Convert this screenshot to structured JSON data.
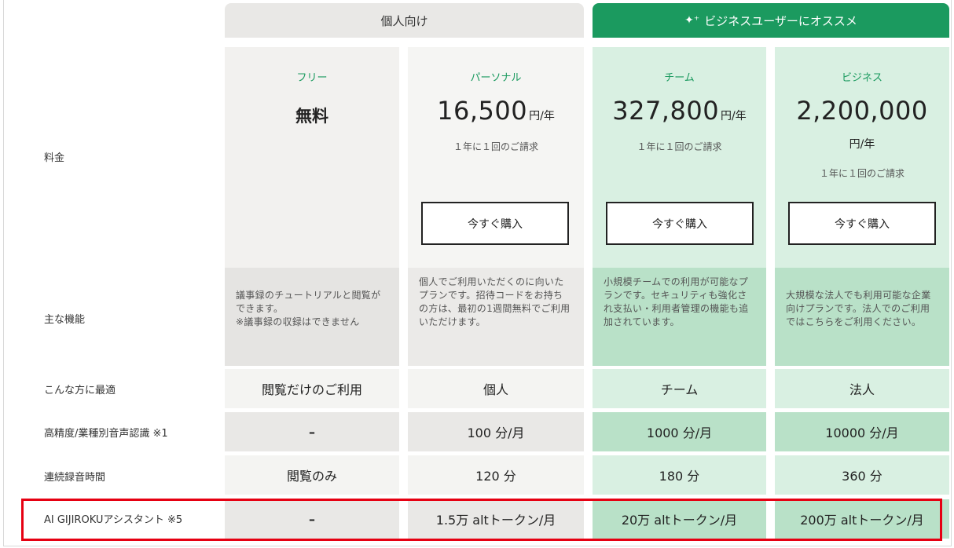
{
  "groups": {
    "personal": "個人向け",
    "business": "ビジネスユーザーにオススメ"
  },
  "row_labels": {
    "price": "料金",
    "features": "主な機能",
    "best_for": "こんな方に最適",
    "recognition": "高精度/業種別音声認識 ※1",
    "recording": "連続録音時間",
    "assistant": "AI GIJIROKUアシスタント ※5"
  },
  "plans": [
    {
      "name": "フリー",
      "price": "無料",
      "features": "議事録のチュートリアルと閲覧ができます。\n※議事録の収録はできません",
      "best_for": "閲覧だけのご利用",
      "recognition": "–",
      "recording": "閲覧のみ",
      "assistant": "–"
    },
    {
      "name": "パーソナル",
      "price": "16,500",
      "unit": "円/年",
      "billing": "１年に１回のご請求",
      "buy": "今すぐ購入",
      "features": "個人でご利用いただくのに向いたプランです。招待コードをお持ちの方は、最初の1週間無料でご利用いただけます。",
      "best_for": "個人",
      "recognition": "100 分/月",
      "recording": "120 分",
      "assistant": "1.5万 altトークン/月"
    },
    {
      "name": "チーム",
      "price": "327,800",
      "unit": "円/年",
      "billing": "１年に１回のご請求",
      "buy": "今すぐ購入",
      "features": "小規模チームでの利用が可能なプランです。セキュリティも強化され支払い・利用者管理の機能も追加されています。",
      "best_for": "チーム",
      "recognition": "1000 分/月",
      "recording": "180 分",
      "assistant": "20万 altトークン/月"
    },
    {
      "name": "ビジネス",
      "price": "2,200,000",
      "unit": "円/年",
      "billing": "１年に１回のご請求",
      "buy": "今すぐ購入",
      "features": "大規模な法人でも利用可能な企業向けプランです。法人でのご利用ではこちらをご利用ください。",
      "best_for": "法人",
      "recognition": "10000 分/月",
      "recording": "360 分",
      "assistant": "200万 altトークン/月"
    }
  ],
  "colors": {
    "accent_green": "#1b9a5f",
    "highlight_red": "#e60012"
  }
}
